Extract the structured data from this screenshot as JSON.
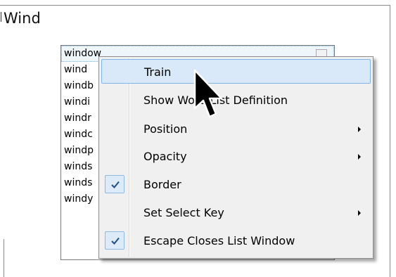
{
  "window": {
    "title": "Wind"
  },
  "word_list": {
    "rows": [
      {
        "text": "window",
        "selected": true
      },
      {
        "text": "wind",
        "selected": false
      },
      {
        "text": "windb",
        "selected": false
      },
      {
        "text": "windi",
        "selected": false
      },
      {
        "text": "windr",
        "selected": false
      },
      {
        "text": "windc",
        "selected": false
      },
      {
        "text": "windp",
        "selected": false
      },
      {
        "text": "winds",
        "selected": false
      },
      {
        "text": "winds",
        "selected": false
      },
      {
        "text": "windy",
        "selected": false
      }
    ]
  },
  "context_menu": {
    "items": [
      {
        "label": "Train",
        "highlighted": true,
        "checked": false,
        "submenu": false
      },
      {
        "label": "Show Word List Definition",
        "highlighted": false,
        "checked": false,
        "submenu": false
      },
      {
        "label": "Position",
        "highlighted": false,
        "checked": false,
        "submenu": true
      },
      {
        "label": "Opacity",
        "highlighted": false,
        "checked": false,
        "submenu": true
      },
      {
        "label": "Border",
        "highlighted": false,
        "checked": true,
        "submenu": false
      },
      {
        "label": "Set Select Key",
        "highlighted": false,
        "checked": false,
        "submenu": true
      },
      {
        "label": "Escape Closes List Window",
        "highlighted": false,
        "checked": true,
        "submenu": false
      }
    ]
  },
  "icons": {
    "check": "checkmark-icon",
    "submenu": "triangle-right-icon",
    "cursor": "arrow-cursor-icon"
  },
  "colors": {
    "menu_background": "#f0f0f0",
    "highlight_fill": "#d9e9f9",
    "highlight_border": "#7eb4ea",
    "check_fill": "#dcebf7",
    "check_mark": "#1f4e8c"
  }
}
